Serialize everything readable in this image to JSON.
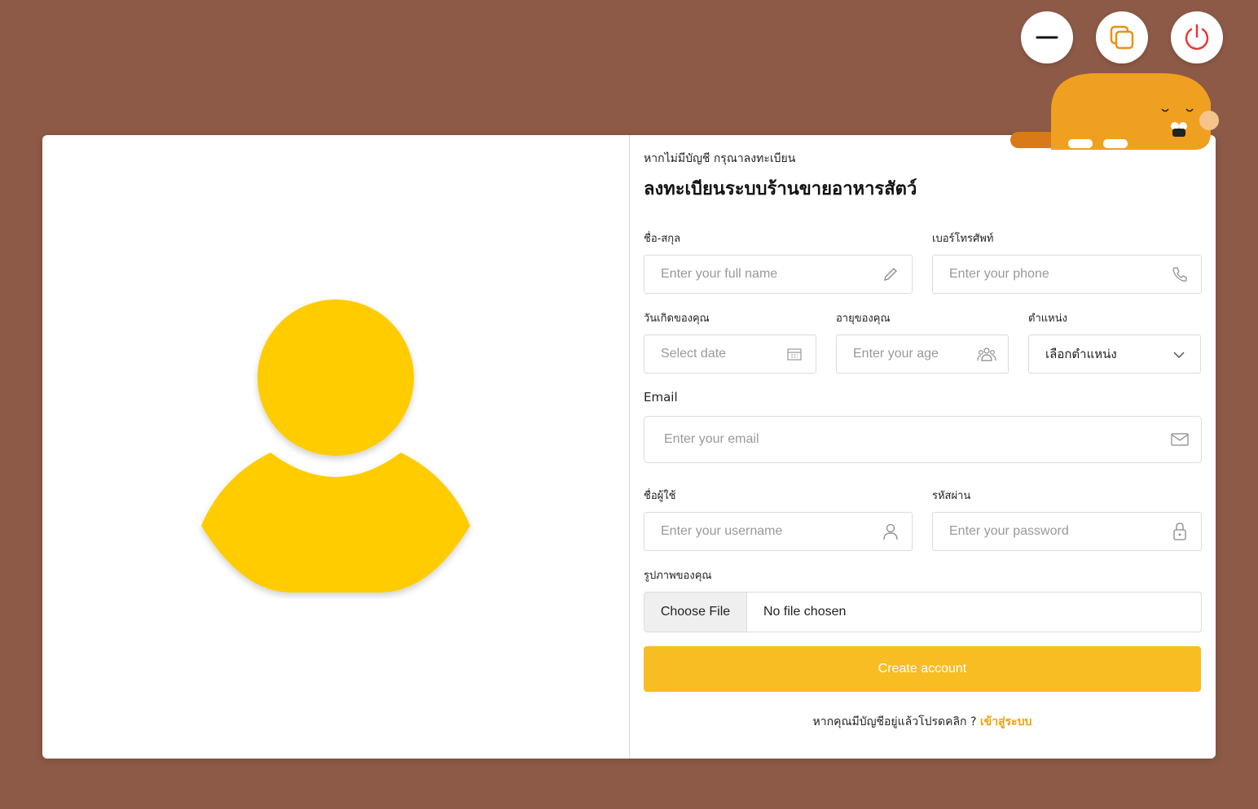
{
  "colors": {
    "background": "#8d5a47",
    "accent": "#f8bd23",
    "avatar": "#ffcc00",
    "link": "#f0a10b",
    "power": "#e53935",
    "cat": "#f0a020"
  },
  "window_controls": {
    "minimize_icon": "minus-icon",
    "maximize_icon": "restore-icon",
    "close_icon": "power-icon"
  },
  "form": {
    "subtitle": "หากไม่มีบัญชี กรุณาลงทะเบียน",
    "title": "ลงทะเบียนระบบร้านขายอาหารสัตว์",
    "fullname": {
      "label": "ชื่อ-สกุล",
      "placeholder": "Enter your full name",
      "icon": "pencil-icon"
    },
    "phone": {
      "label": "เบอร์โทรศัพท์",
      "placeholder": "Enter your phone",
      "icon": "phone-icon"
    },
    "birthdate": {
      "label": "วันเกิดของคุณ",
      "placeholder": "Select date",
      "icon": "calendar-icon"
    },
    "age": {
      "label": "อายุของคุณ",
      "placeholder": "Enter your age",
      "icon": "people-icon"
    },
    "position": {
      "label": "ตำแหน่ง",
      "selected": "เลือกตำแหน่ง",
      "icon": "chevron-down-icon"
    },
    "email": {
      "label": "Email",
      "placeholder": "Enter your email",
      "icon": "mail-icon"
    },
    "username": {
      "label": "ชื่อผู้ใช้",
      "placeholder": "Enter your username",
      "icon": "user-icon"
    },
    "password": {
      "label": "รหัสผ่าน",
      "placeholder": "Enter your password",
      "icon": "lock-icon"
    },
    "photo": {
      "label": "รูปภาพของคุณ",
      "button": "Choose File",
      "status": "No file chosen"
    },
    "submit_label": "Create account",
    "footer_text": "หากคุณมีบัญชีอยู่แล้วโปรดคลิก ? ",
    "login_link": "เข้าสู่ระบบ"
  }
}
